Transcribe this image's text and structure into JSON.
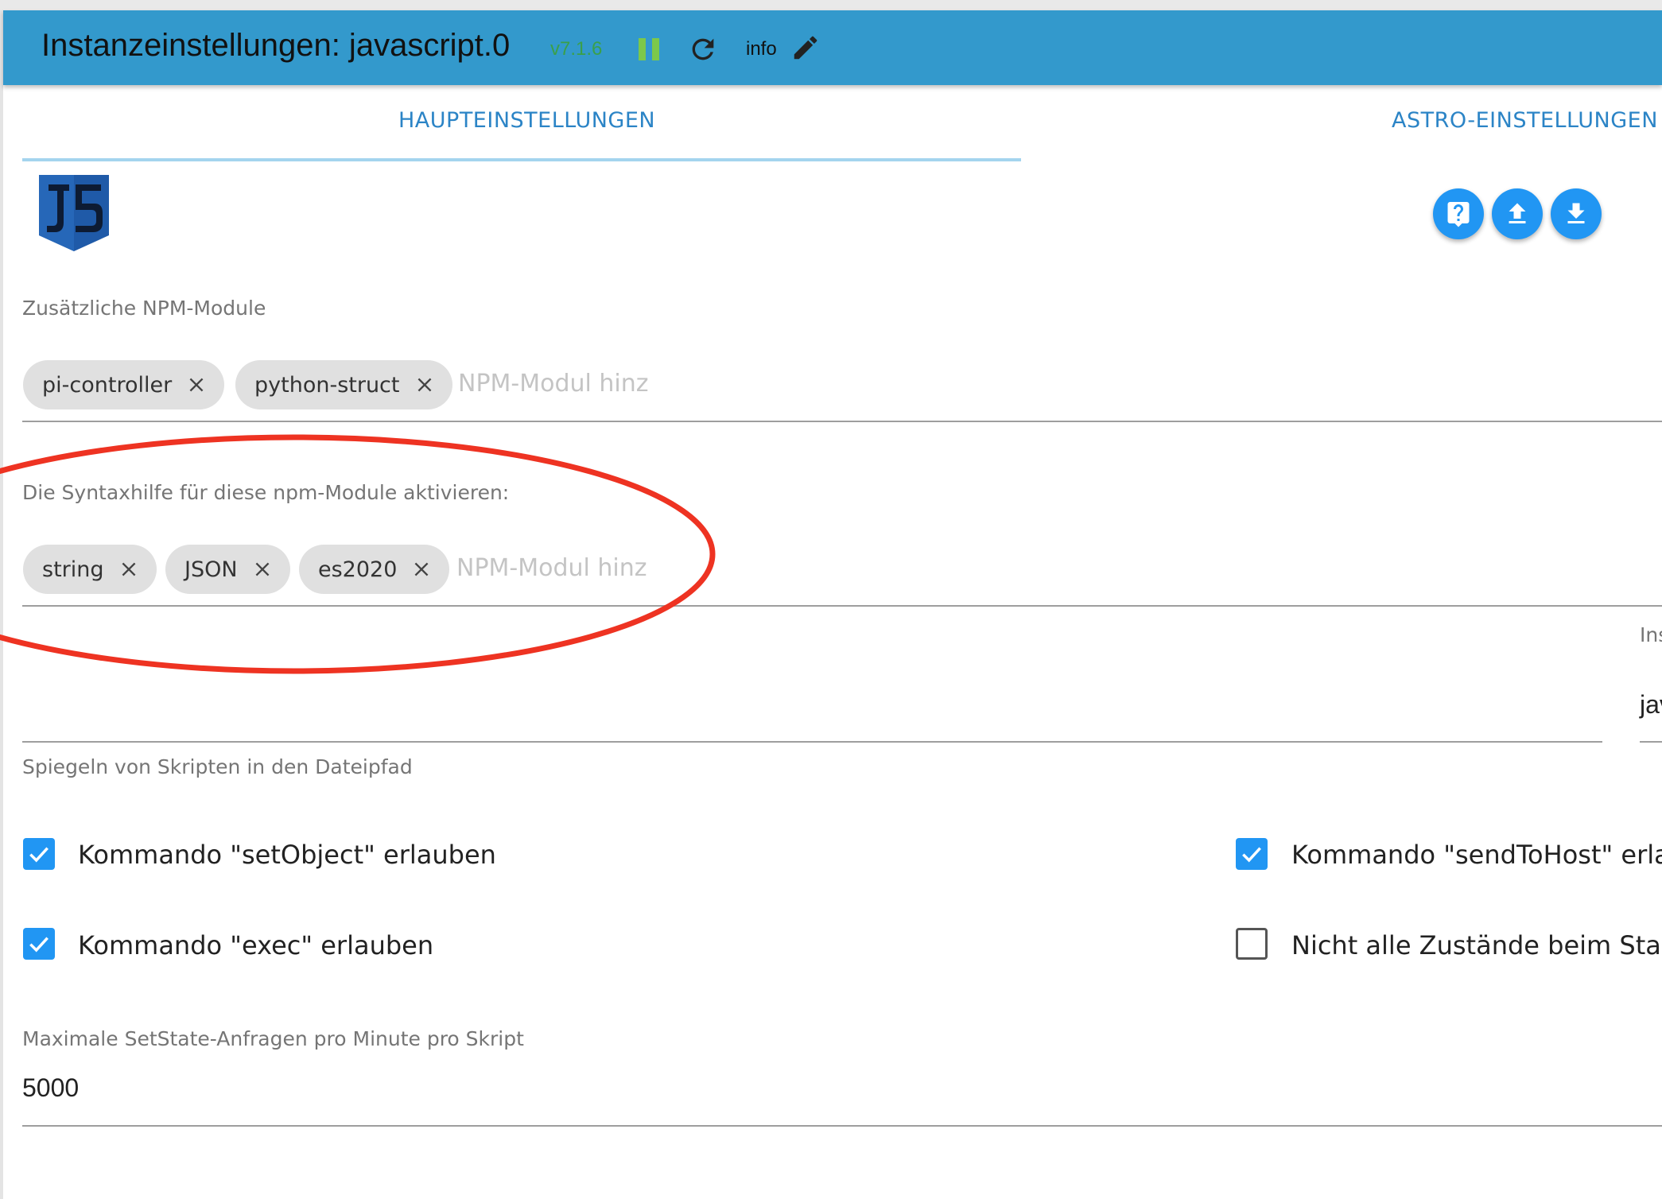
{
  "header": {
    "title": "Instanzeinstellungen: javascript.0",
    "version": "v7.1.6",
    "info_label": "info",
    "bar_color": "#3399cc",
    "version_color": "#3aa04a",
    "pause_icon": "pause-icon",
    "refresh_icon": "refresh-icon",
    "edit_icon": "pencil-icon"
  },
  "tabs": [
    {
      "label": "HAUPTEINSTELLUNGEN",
      "active": true
    },
    {
      "label": "ASTRO-EINSTELLUNGEN",
      "active": false
    }
  ],
  "logo": {
    "text": "JS",
    "icon": "js-logo-icon",
    "color": "#1f5aa8"
  },
  "actions": [
    {
      "name": "help",
      "icon": "help-chat-icon"
    },
    {
      "name": "upload",
      "icon": "upload-icon"
    },
    {
      "name": "download",
      "icon": "download-icon"
    }
  ],
  "npm_modules": {
    "label": "Zusätzliche NPM-Module",
    "chips": [
      "pi-controller",
      "python-struct"
    ],
    "placeholder": "NPM-Modul hinzufügen"
  },
  "syntax_help": {
    "label": "Die Syntaxhilfe für diese npm-Module aktivieren:",
    "chips": [
      "string",
      "JSON",
      "es2020"
    ],
    "placeholder": "NPM-Modul hinzufügen"
  },
  "mirror_path": {
    "label": "Spiegeln von Skripten in den Dateipfad",
    "value": ""
  },
  "instance_field": {
    "label_fragment": "Ins",
    "value_fragment": "jav"
  },
  "checkboxes": [
    {
      "label": "Kommando \"setObject\" erlauben",
      "checked": true
    },
    {
      "label": "Kommando \"sendToHost\" erlauben",
      "checked": true
    },
    {
      "label": "Kommando \"exec\" erlauben",
      "checked": true
    },
    {
      "label": "Nicht alle Zustände beim Start",
      "checked": false
    }
  ],
  "max_setstate": {
    "label": "Maximale SetState-Anfragen pro Minute pro Skript",
    "value": "5000"
  },
  "colors": {
    "accent": "#2196f3",
    "tab_text": "#2b84c6",
    "tab_indicator": "#a4d4ee",
    "chip_bg": "#e0e0e0",
    "annotation": "#ee3322"
  }
}
